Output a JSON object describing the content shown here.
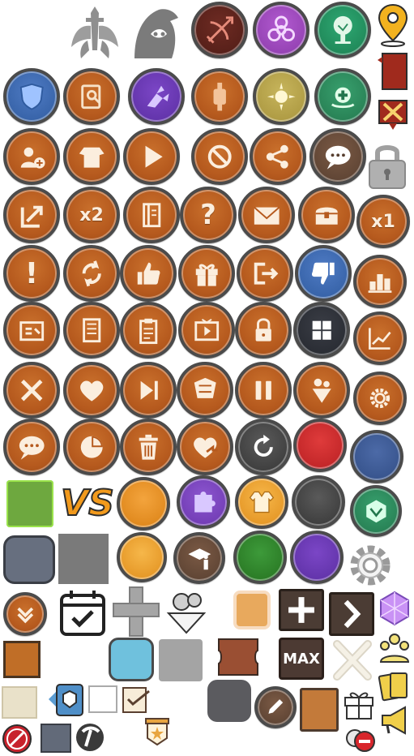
{
  "sheet": {
    "labels": {
      "x2": "x2",
      "x1": "x1",
      "vs": "VS",
      "max": "MAX"
    }
  },
  "icons": [
    "sword-wings-icon",
    "wizard-hood-icon",
    "crossed-bow-icon",
    "biohazard-icon",
    "tree-emblem-icon",
    "map-pin-icon",
    "red-banner-icon",
    "shield-icon",
    "magnifier-document-icon",
    "claw-icon",
    "hammer-icon",
    "sun-icon",
    "heal-icon",
    "crossed-swords-tag-icon",
    "add-person-icon",
    "armor-icon",
    "play-icon",
    "cancel-icon",
    "share-icon",
    "chat-icon",
    "padlock-icon",
    "exit-arrow-icon",
    "multiplier-icon",
    "journal-icon",
    "help-icon",
    "mail-icon",
    "chest-icon",
    "multiplier-icon",
    "alert-icon",
    "refresh-icon",
    "thumbs-up-icon",
    "gift-icon",
    "logout-icon",
    "thumbs-down-icon",
    "leaderboard-icon",
    "id-card-icon",
    "notes-icon",
    "clipboard-icon",
    "video-icon",
    "lock-icon",
    "grid-icon",
    "trend-icon",
    "battle-icon",
    "heart-icon",
    "skip-icon",
    "armor-stack-icon",
    "pause-icon",
    "person-down-icon",
    "settings-icon",
    "chat-icon",
    "pie-icon",
    "trash-icon",
    "heart-share-icon",
    "restart-icon",
    "vs-icon",
    "puzzle-icon",
    "jacket-icon",
    "emblem-icon",
    "info-hat-icon",
    "gear-icon",
    "chevron-down-icon",
    "calendar-check-icon",
    "plus-icon",
    "avatar-icon",
    "plus-icon",
    "next-icon",
    "gem-icon",
    "max-icon",
    "close-icon",
    "group-icon",
    "cards-icon",
    "tag-icon",
    "pencil-icon",
    "gift-icon",
    "megaphone-icon",
    "no-ads-icon",
    "pickaxe-icon",
    "star-badge-icon",
    "remove-icon"
  ]
}
